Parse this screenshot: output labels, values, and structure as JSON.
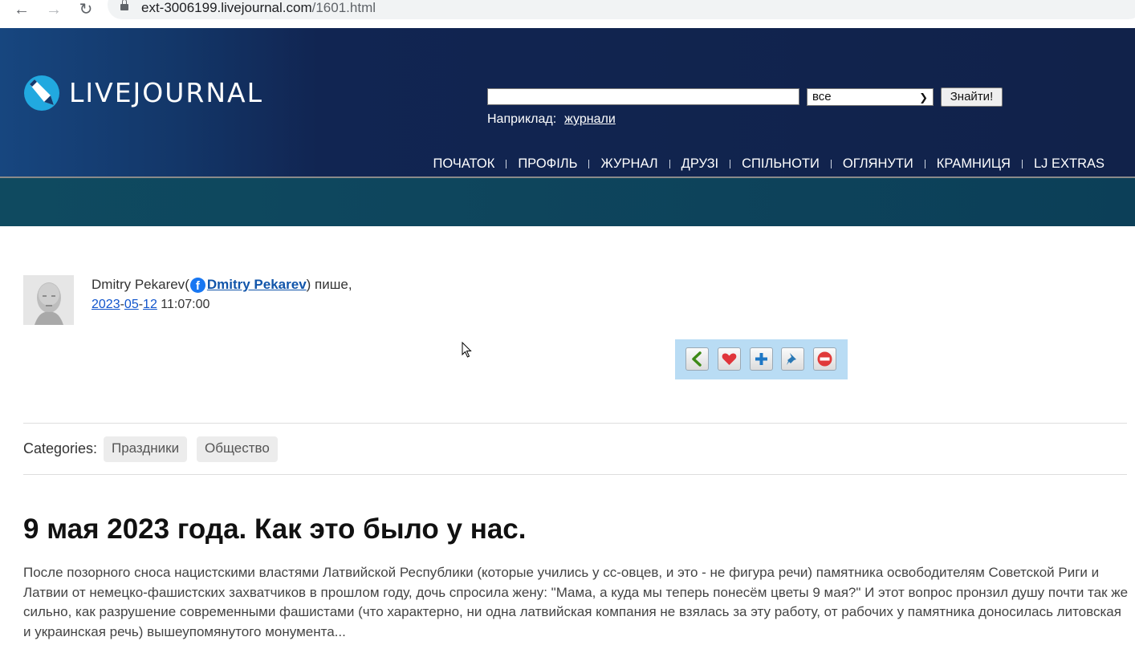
{
  "browser": {
    "url_host": "ext-3006199.livejournal.com",
    "url_path": "/1601.html"
  },
  "header": {
    "logo_text": "LIVEJOURNAL",
    "search": {
      "value": "",
      "scope_selected": "все",
      "button_label": "Знайти!",
      "example_label": "Наприклад:",
      "example_link": "журнали"
    },
    "nav": [
      {
        "label": "ПОЧАТОК"
      },
      {
        "label": "ПРОФІЛЬ"
      },
      {
        "label": "ЖУРНАЛ"
      },
      {
        "label": "ДРУЗІ"
      },
      {
        "label": "СПІЛЬНОТИ"
      },
      {
        "label": "ОГЛЯНУТИ"
      },
      {
        "label": "КРАМНИЦЯ"
      },
      {
        "label": "LJ EXTRAS"
      }
    ]
  },
  "entry": {
    "author_name": "Dmitry Pekarev",
    "author_open": " (",
    "author_link": "Dmitry Pekarev",
    "author_close": ") пише,",
    "date_year": "2023",
    "date_month": "05",
    "date_day": "12",
    "date_sep": "-",
    "time": " 11:07:00",
    "actions": [
      {
        "name": "back-icon"
      },
      {
        "name": "heart-icon"
      },
      {
        "name": "plus-icon"
      },
      {
        "name": "pin-icon"
      },
      {
        "name": "block-icon"
      }
    ],
    "categories_label": "Categories:",
    "tags": [
      "Праздники",
      "Общество"
    ],
    "title": "9 мая 2023 года. Как это было у нас.",
    "body": "После позорного сноса нацистскими властями Латвийской Республики (которые учились у сс-овцев, и это - не фигура речи) памятника освободителям Советской Риги и Латвии от немецко-фашистских захватчиков в прошлом году, дочь спросила жену: \"Мама, а куда мы теперь понесём цветы 9 мая?\" И этот вопрос пронзил душу почти так же сильно, как разрушение современными фашистами (что характерно, ни одна латвийская компания не взялась за эту работу, от рабочих у памятника доносилась литовская и украинская речь) вышеупомянутого монумента..."
  },
  "colors": {
    "header_bg": "#112552",
    "header_bg_left": "#17467f",
    "sub_band": "#0f4a60",
    "link": "#1155cc",
    "action_bar": "#b9dcf4",
    "facebook": "#1877f2"
  }
}
